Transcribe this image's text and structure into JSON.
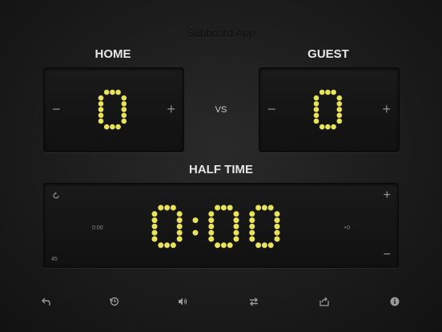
{
  "app": {
    "title": "Subboard App"
  },
  "home": {
    "label": "HOME",
    "score": "0",
    "minus": "−",
    "plus": "+"
  },
  "guest": {
    "label": "GUEST",
    "score": "0",
    "minus": "−",
    "plus": "+"
  },
  "vs": "VS",
  "period": {
    "label": "HALF TIME"
  },
  "timer": {
    "minutes": "0",
    "separator": ":",
    "seconds": "00",
    "left_time": "0:00",
    "right_offset": "+0",
    "bottom_left": "45",
    "plus": "+",
    "minus": "−"
  },
  "colors": {
    "led": "#e8e35a",
    "led_dim": "#3a3a1a"
  },
  "toolbar": {
    "icons": [
      "undo-icon",
      "reset-clock-icon",
      "sound-icon",
      "swap-icon",
      "share-icon",
      "info-icon"
    ]
  }
}
